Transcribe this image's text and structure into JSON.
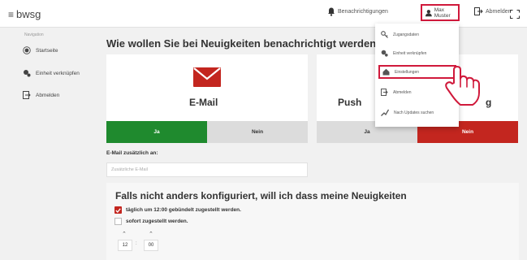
{
  "topbar": {
    "logo": "bwsg",
    "notifications_label": "Benachrichtigungen",
    "user_label": "Max Muster",
    "logout_label": "Abmelden"
  },
  "sidebar": {
    "caption": "Navigation",
    "items": [
      {
        "label": "Startseite"
      },
      {
        "label": "Einheit verknüpfen"
      },
      {
        "label": "Abmelden"
      }
    ]
  },
  "main": {
    "title": "Wie wollen Sie bei Neuigkeiten benachrichtigt werden?",
    "email_card": {
      "label": "E-Mail",
      "yes": "Ja",
      "no": "Nein"
    },
    "push_card": {
      "label_left": "Push",
      "label_right": "g",
      "yes": "Ja",
      "no": "Nein"
    },
    "email_extra_label": "E-Mail zusätzlich an:",
    "email_extra_placeholder": "Zusätzliche E-Mail",
    "schedule_title": "Falls nicht anders konfiguriert, will ich dass meine Neuigkeiten",
    "option_daily": "täglich um 12:00 gebündelt zugestellt werden.",
    "option_daily_checked": true,
    "option_instant": "sofort zugestellt werden.",
    "option_instant_checked": false,
    "hour": "12",
    "minute": "00"
  },
  "dropdown": {
    "items": [
      {
        "label": "Zugangsdaten"
      },
      {
        "label": "Einheit verknüpfen"
      },
      {
        "label": "Einstellungen"
      },
      {
        "label": "Abmelden"
      },
      {
        "label": "Nach Updates suchen"
      }
    ]
  },
  "colors": {
    "accent_red": "#c3261f",
    "highlight_red": "#d0193b",
    "green": "#1f8a2e"
  }
}
